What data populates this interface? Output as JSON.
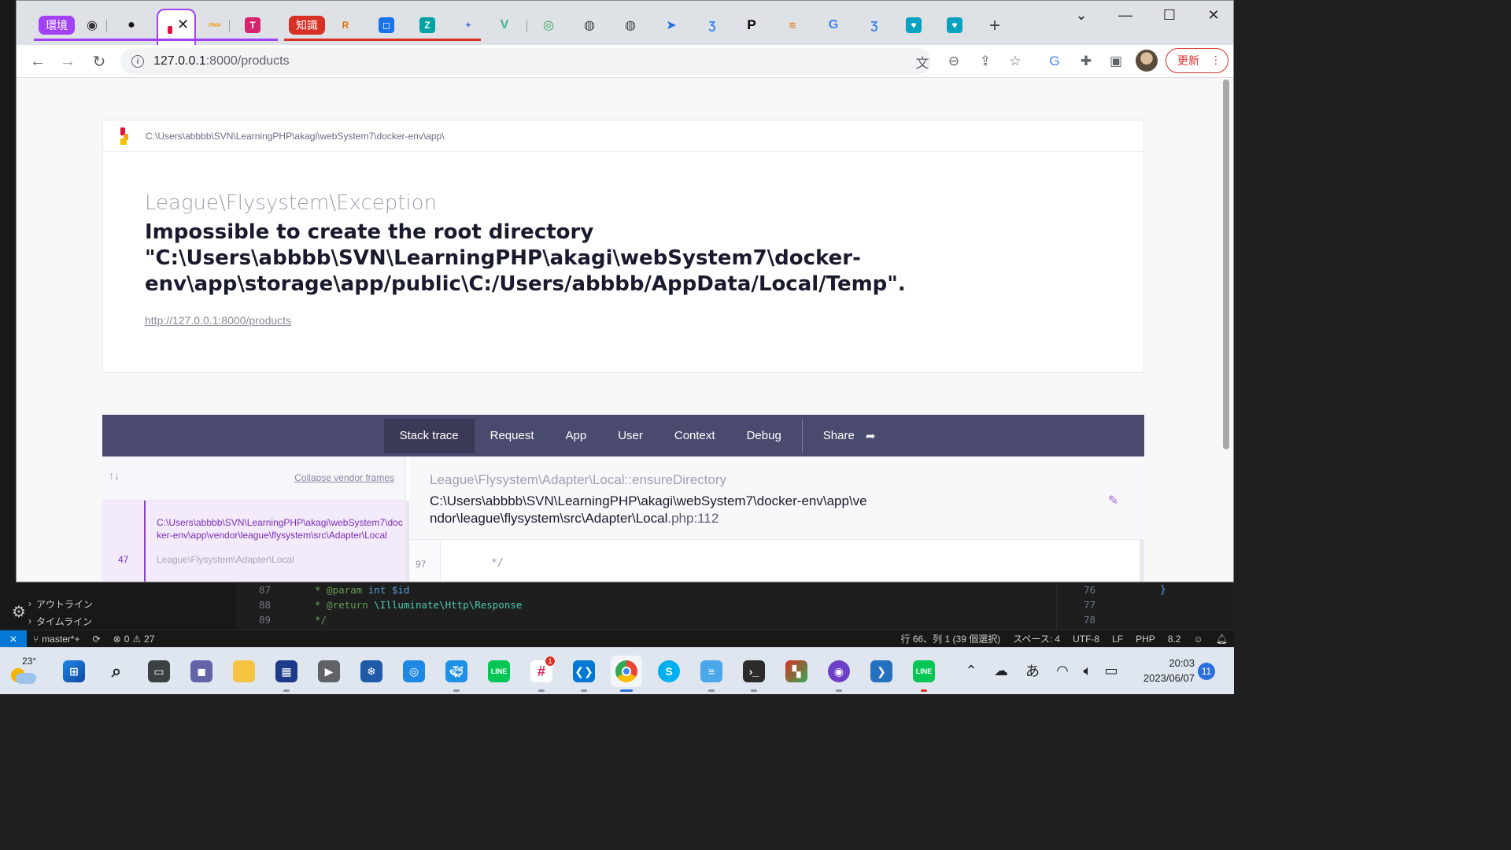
{
  "browser": {
    "tab_group_1": "環境",
    "tab_group_2": "知識",
    "tab_group_1_color": "#a142f4",
    "tab_group_2_color": "#d93025",
    "pma_label": "PMA",
    "url_host": "127.0.0.1",
    "url_path": ":8000/products",
    "update_label": "更新"
  },
  "page": {
    "header_path": "C:\\Users\\abbbb\\SVN\\LearningPHP\\akagi\\webSystem7\\docker-env\\app\\",
    "exception_class": "League\\Flysystem\\Exception",
    "exception_message": "Impossible to create the root directory \"C:\\Users\\abbbb\\SVN\\LearningPHP\\akagi\\webSystem7\\docker-env\\app\\storage\\app/public\\C:/Users/abbbb/AppData/Local/Temp\".",
    "request_url": "http://127.0.0.1:8000/products",
    "tabs": [
      {
        "label": "Stack trace"
      },
      {
        "label": "Request"
      },
      {
        "label": "App"
      },
      {
        "label": "User"
      },
      {
        "label": "Context"
      },
      {
        "label": "Debug"
      }
    ],
    "share_label": "Share",
    "collapse_label": "Collapse vendor frames",
    "frame": {
      "file": "C:\\Users\\abbbb\\SVN\\LearningPHP\\akagi\\webSystem7\\docker-env\\app\\vendor\\league\\flysystem\\src\\Adapter\\Local",
      "line": "47",
      "class": "League\\Flysystem\\Adapter\\Local"
    },
    "detail": {
      "method": "League\\Flysystem\\Adapter\\Local::ensureDirectory",
      "file": "C:\\Users\\abbbb\\SVN\\LearningPHP\\akagi\\webSystem7\\docker-env\\app\\vendor\\league\\flysystem\\src\\Adapter\\Local",
      "ext": ".php:112",
      "code_line_num": "97",
      "code_line": "*/"
    }
  },
  "vscode": {
    "outline_label": "アウトライン",
    "timeline_label": "タイムライン",
    "lines": [
      "87",
      "88",
      "89"
    ],
    "code_line_1_a": "* @param",
    "code_line_1_b": "int",
    "code_line_1_c": "$id",
    "code_line_2_a": "* @return",
    "code_line_2_b": "\\Illuminate\\Http\\",
    "code_line_2_c": "Response",
    "code_line_3": "*/",
    "mini_lines": [
      "76",
      "77",
      "78"
    ],
    "mini_brace": "}",
    "status": {
      "branch": "master*+",
      "errors": "0",
      "warnings": "27",
      "position": "行 66、列 1 (39 個選択)",
      "spaces": "スペース: 4",
      "encoding": "UTF-8",
      "eol": "LF",
      "language": "PHP",
      "version": "8.2"
    }
  },
  "taskbar": {
    "temperature": "23°",
    "time": "20:03",
    "date": "2023/06/07",
    "notifications": "11",
    "slack_badge": "1",
    "ime": "あ"
  }
}
